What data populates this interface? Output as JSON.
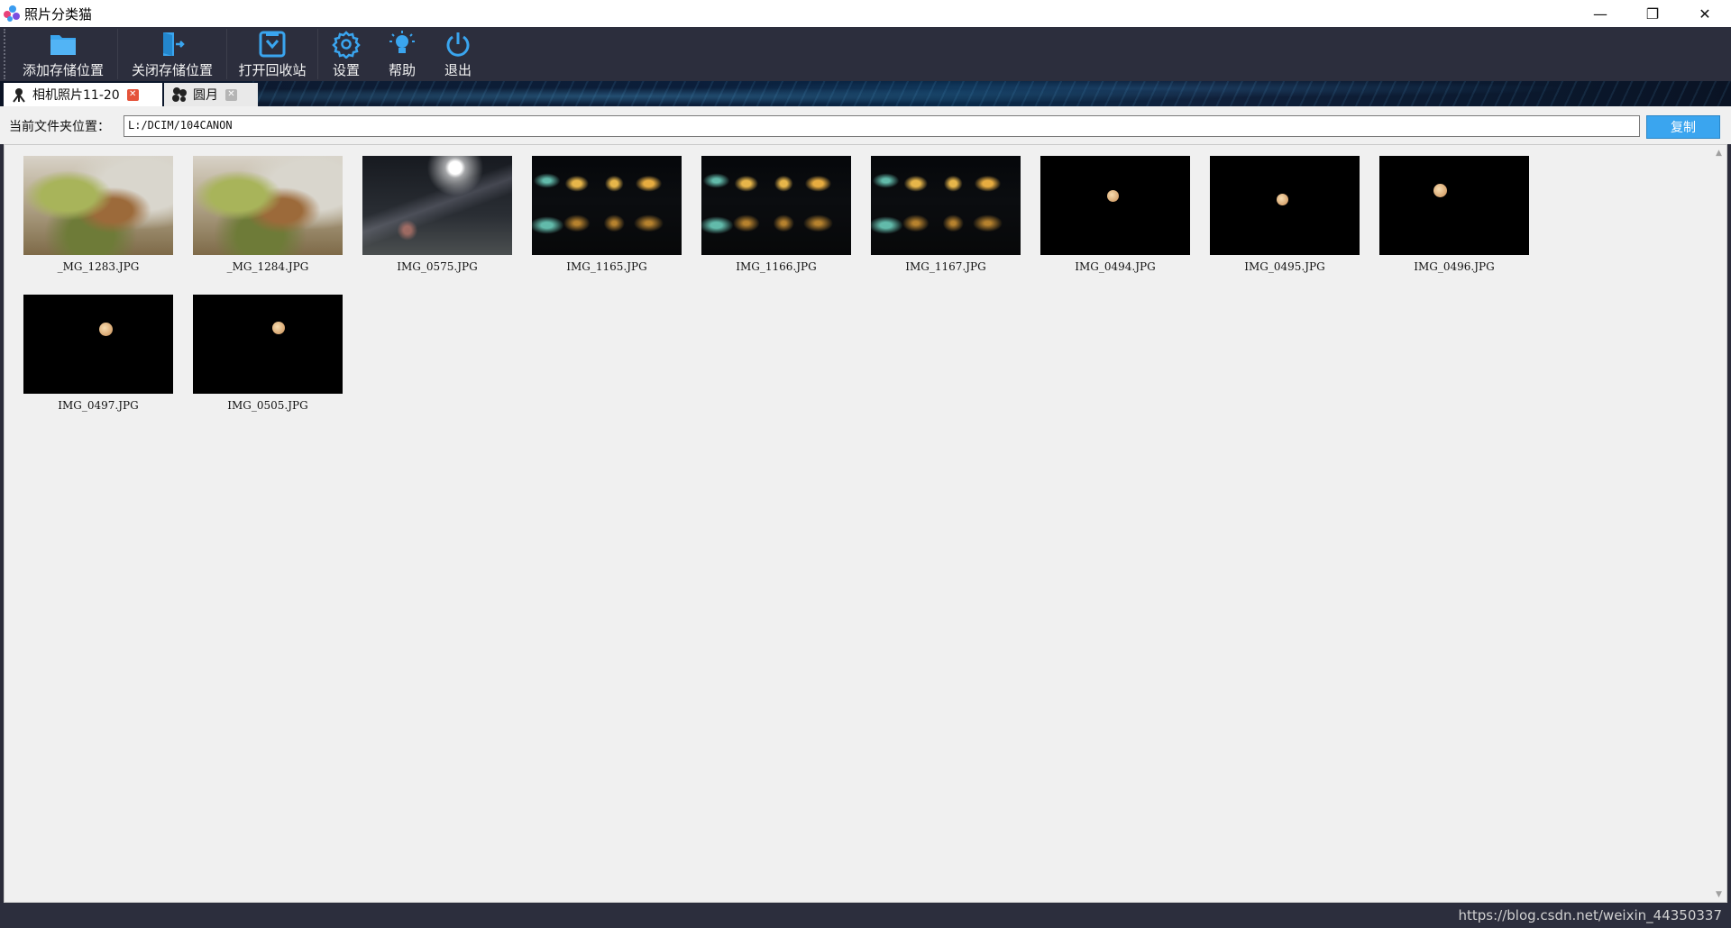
{
  "window": {
    "title": "照片分类猫",
    "controls": {
      "minimize": "—",
      "restore": "❐",
      "close": "✕"
    }
  },
  "toolbar": {
    "items": [
      {
        "label": "添加存储位置",
        "icon": "folder-icon"
      },
      {
        "label": "关闭存储位置",
        "icon": "door-exit-icon"
      },
      {
        "label": "打开回收站",
        "icon": "recycle-box-icon"
      },
      {
        "label": "设置",
        "icon": "gear-icon"
      },
      {
        "label": "帮助",
        "icon": "lightbulb-icon"
      },
      {
        "label": "退出",
        "icon": "power-icon"
      }
    ],
    "accent_color": "#3aa5ef"
  },
  "tabs": [
    {
      "label": "相机照片11-20",
      "active": true,
      "close": "✕"
    },
    {
      "label": "圆月",
      "active": false,
      "close": "✕"
    }
  ],
  "pathbar": {
    "label": "当前文件夹位置：",
    "value": "L:/DCIM/104CANON",
    "copy_label": "复制"
  },
  "photos": [
    {
      "name": "_MG_1283.JPG",
      "kind": "lotus"
    },
    {
      "name": "_MG_1284.JPG",
      "kind": "lotus"
    },
    {
      "name": "IMG_0575.JPG",
      "kind": "street"
    },
    {
      "name": "IMG_1165.JPG",
      "kind": "night"
    },
    {
      "name": "IMG_1166.JPG",
      "kind": "night"
    },
    {
      "name": "IMG_1167.JPG",
      "kind": "night"
    },
    {
      "name": "IMG_0494.JPG",
      "kind": "moon"
    },
    {
      "name": "IMG_0495.JPG",
      "kind": "moon"
    },
    {
      "name": "IMG_0496.JPG",
      "kind": "moon"
    },
    {
      "name": "IMG_0497.JPG",
      "kind": "moon"
    },
    {
      "name": "IMG_0505.JPG",
      "kind": "moon"
    }
  ],
  "statusbar": {
    "watermark": "https://blog.csdn.net/weixin_44350337"
  }
}
